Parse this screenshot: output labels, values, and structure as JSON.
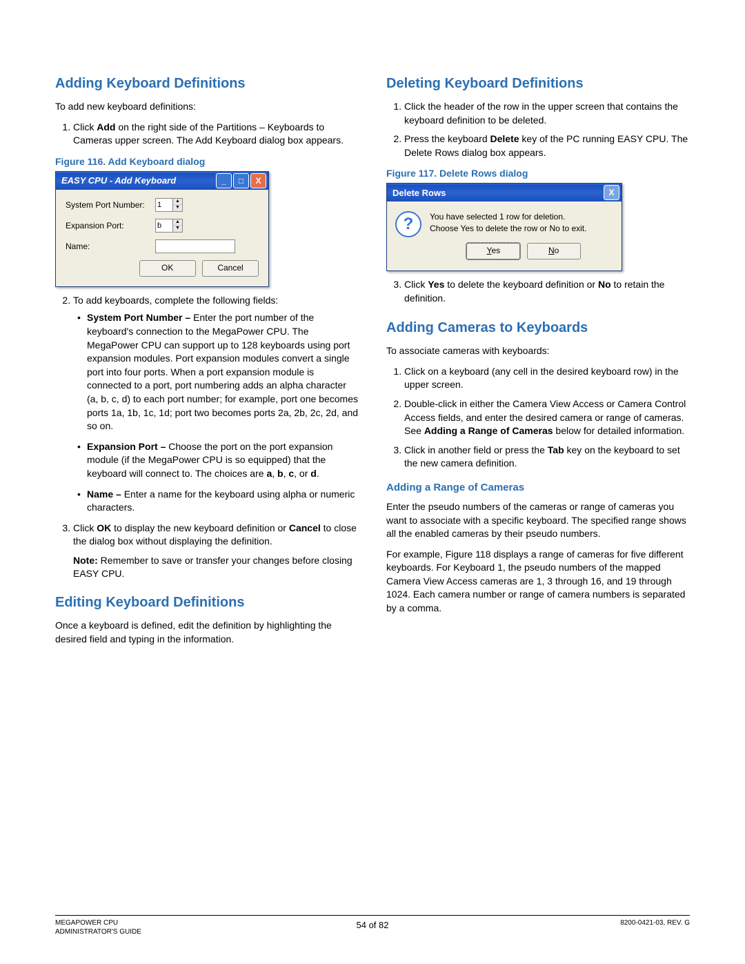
{
  "left": {
    "h_adding": "Adding Keyboard Definitions",
    "p_toadd": "To add new keyboard definitions:",
    "li1_a": "Click ",
    "li1_b": "Add",
    "li1_c": " on the right side of the Partitions – Keyboards to Cameras upper screen. The Add Keyboard dialog box appears.",
    "fig116": "Figure 116. Add Keyboard dialog",
    "dlg1": {
      "title": "EASY CPU - Add Keyboard",
      "lbl_sys": "System Port Number:",
      "val_sys": "1",
      "lbl_exp": "Expansion Port:",
      "val_exp": "b",
      "lbl_name": "Name:",
      "btn_ok": "OK",
      "btn_cancel": "Cancel"
    },
    "li2": "To add keyboards, complete the following fields:",
    "b_sys_a": "System Port Number – ",
    "b_sys_b": "Enter the port number of the keyboard's connection to the MegaPower CPU. The MegaPower CPU can support up to 128 keyboards using port expansion modules. Port expansion modules convert a single port into four ports. When a port expansion module is connected to a port, port numbering adds an alpha character (a, b, c, d) to each port number; for example, port one becomes ports 1a, 1b, 1c, 1d; port two becomes ports 2a, 2b, 2c, 2d, and so on.",
    "b_exp_a": "Expansion Port – ",
    "b_exp_b": "Choose the port on the port expansion module (if the MegaPower CPU is so equipped) that the keyboard will connect to. The choices are ",
    "b_exp_c": "a",
    "b_exp_d": ", ",
    "b_exp_e": "b",
    "b_exp_f": ", ",
    "b_exp_g": "c",
    "b_exp_h": ", or ",
    "b_exp_i": "d",
    "b_exp_j": ".",
    "b_name_a": "Name – ",
    "b_name_b": "Enter a name for the keyboard using alpha or numeric characters.",
    "li3_a": "Click ",
    "li3_b": "OK",
    "li3_c": " to display the new keyboard definition or ",
    "li3_d": "Cancel",
    "li3_e": " to close the dialog box without displaying the definition.",
    "note_a": "Note:",
    "note_b": " Remember to save or transfer your changes before closing EASY CPU.",
    "h_editing": "Editing Keyboard Definitions",
    "p_editing": "Once a keyboard is defined, edit the definition by highlighting the desired field and typing in the information."
  },
  "right": {
    "h_deleting": "Deleting Keyboard Definitions",
    "d_li1": "Click the header of the row in the upper screen that contains the keyboard definition to be deleted.",
    "d_li2_a": "Press the keyboard ",
    "d_li2_b": "Delete",
    "d_li2_c": " key of the PC running EASY CPU. The Delete Rows dialog box appears.",
    "fig117": "Figure 117. Delete Rows dialog",
    "dlg2": {
      "title": "Delete Rows",
      "msg1": "You have selected 1 row for deletion.",
      "msg2": "Choose Yes to delete the row or No to exit.",
      "btn_yes_u": "Y",
      "btn_yes_r": "es",
      "btn_no_u": "N",
      "btn_no_r": "o"
    },
    "d_li3_a": "Click ",
    "d_li3_b": "Yes",
    "d_li3_c": " to delete the keyboard definition or ",
    "d_li3_d": "No",
    "d_li3_e": " to retain the definition.",
    "h_addcam": "Adding Cameras to Keyboards",
    "p_assoc": "To associate cameras with keyboards:",
    "c_li1": "Click on a keyboard (any cell in the desired keyboard row) in the upper screen.",
    "c_li2_a": "Double-click in either the Camera View Access or Camera Control Access fields, and enter the desired camera or range of cameras. See ",
    "c_li2_b": "Adding a Range of Cameras",
    "c_li2_c": " below for detailed information.",
    "c_li3_a": "Click in another field or press the ",
    "c_li3_b": "Tab",
    "c_li3_c": " key on the keyboard to set the new camera definition.",
    "h_range": "Adding a Range of Cameras",
    "p_range1": "Enter the pseudo numbers of the cameras or range of cameras you want to associate with a specific keyboard. The specified range shows all the enabled cameras by their pseudo numbers.",
    "p_range2": "For example, Figure 118 displays a range of cameras for five different keyboards. For Keyboard 1, the pseudo numbers of the mapped Camera View Access cameras are 1, 3 through 16, and 19 through 1024. Each camera number or range of camera numbers is separated by a comma."
  },
  "footer": {
    "left1": "MEGAPOWER CPU",
    "left2": "ADMINISTRATOR'S GUIDE",
    "center": "54 of 82",
    "right": "8200-0421-03, REV. G"
  }
}
